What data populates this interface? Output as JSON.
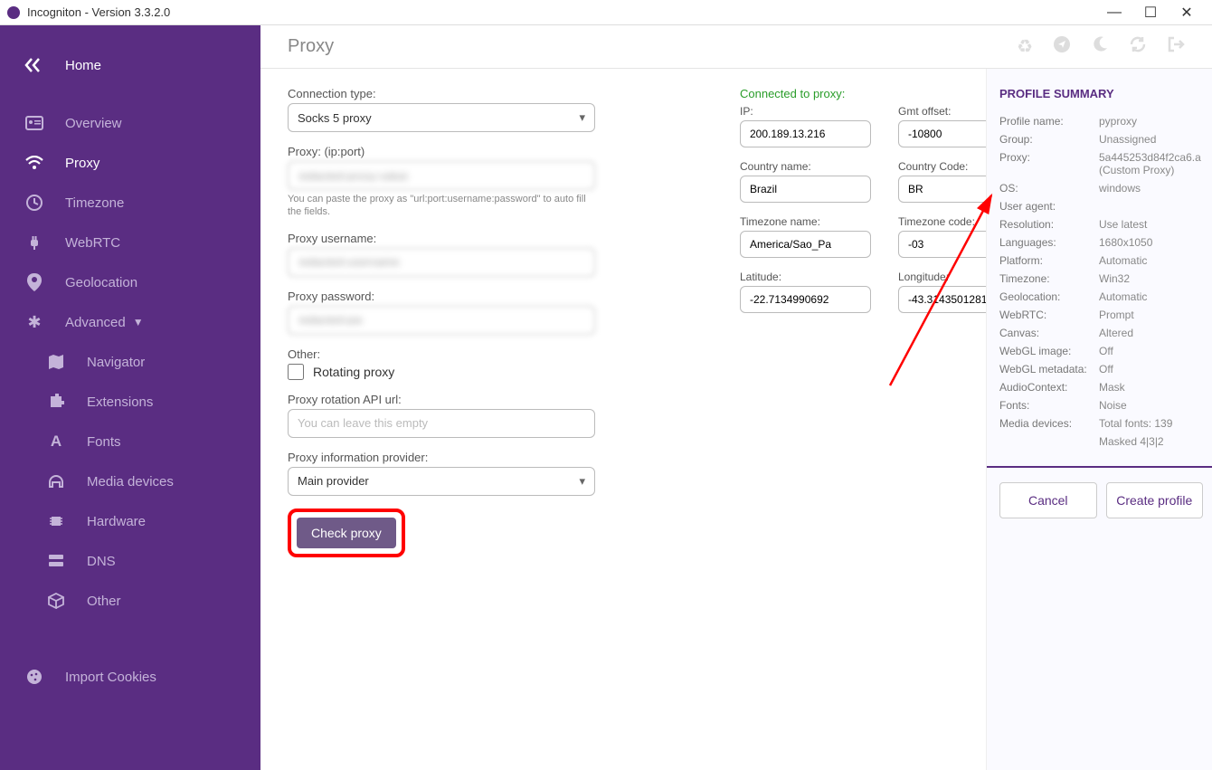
{
  "title": "Incogniton - Version 3.3.2.0",
  "sidebar": {
    "home": "Home",
    "overview": "Overview",
    "proxy": "Proxy",
    "timezone": "Timezone",
    "webrtc": "WebRTC",
    "geolocation": "Geolocation",
    "advanced": "Advanced",
    "navigator": "Navigator",
    "extensions": "Extensions",
    "fonts": "Fonts",
    "media_devices": "Media devices",
    "hardware": "Hardware",
    "dns": "DNS",
    "other": "Other",
    "import_cookies": "Import Cookies"
  },
  "page_heading": "Proxy",
  "form": {
    "connection_type_label": "Connection type:",
    "connection_type_value": "Socks 5 proxy",
    "proxy_label": "Proxy: (ip:port)",
    "proxy_value": "redacted-proxy-value",
    "proxy_help": "You can paste the proxy as \"url:port:username:password\" to auto fill the fields.",
    "proxy_username_label": "Proxy username:",
    "proxy_username_value": "redacted-username",
    "proxy_password_label": "Proxy password:",
    "proxy_password_value": "redacted-pw",
    "other_label": "Other:",
    "rotating_checkbox_label": "Rotating proxy",
    "rotation_api_label": "Proxy rotation API url:",
    "rotation_api_placeholder": "You can leave this empty",
    "provider_label": "Proxy information provider:",
    "provider_value": "Main provider",
    "check_proxy_btn": "Check proxy"
  },
  "proxy_status": {
    "connected_label": "Connected to proxy:",
    "ip_label": "IP:",
    "ip_value": "200.189.13.216",
    "gmt_label": "Gmt offset:",
    "gmt_value": "-10800",
    "country_name_label": "Country name:",
    "country_name_value": "Brazil",
    "country_code_label": "Country Code:",
    "country_code_value": "BR",
    "tz_name_label": "Timezone name:",
    "tz_name_value": "America/Sao_Pa",
    "tz_code_label": "Timezone code:",
    "tz_code_value": "-03",
    "lat_label": "Latitude:",
    "lat_value": "-22.7134990692",
    "lon_label": "Longitude:",
    "lon_value": "-43.3143501281"
  },
  "summary": {
    "title": "PROFILE SUMMARY",
    "rows": [
      {
        "k": "Profile name:",
        "v": "pyproxy"
      },
      {
        "k": "Group:",
        "v": "Unassigned"
      },
      {
        "k": "Proxy:",
        "v": "5a445253d84f2ca6.a (Custom Proxy)"
      },
      {
        "k": "OS:",
        "v": "windows"
      },
      {
        "k": "User agent:",
        "v": ""
      },
      {
        "k": "Resolution:",
        "v": "Use latest"
      },
      {
        "k": "Languages:",
        "v": "1680x1050"
      },
      {
        "k": "Platform:",
        "v": "Automatic"
      },
      {
        "k": "Timezone:",
        "v": "Win32"
      },
      {
        "k": "Geolocation:",
        "v": "Automatic"
      },
      {
        "k": "WebRTC:",
        "v": "Prompt"
      },
      {
        "k": "Canvas:",
        "v": "Altered"
      },
      {
        "k": "WebGL image:",
        "v": "Off"
      },
      {
        "k": "WebGL metadata:",
        "v": "Off"
      },
      {
        "k": "AudioContext:",
        "v": "Mask"
      },
      {
        "k": "Fonts:",
        "v": "Noise"
      },
      {
        "k": "Media devices:",
        "v": "Total fonts: 139"
      },
      {
        "k": "",
        "v": "Masked 4|3|2"
      }
    ],
    "cancel": "Cancel",
    "create": "Create profile"
  }
}
